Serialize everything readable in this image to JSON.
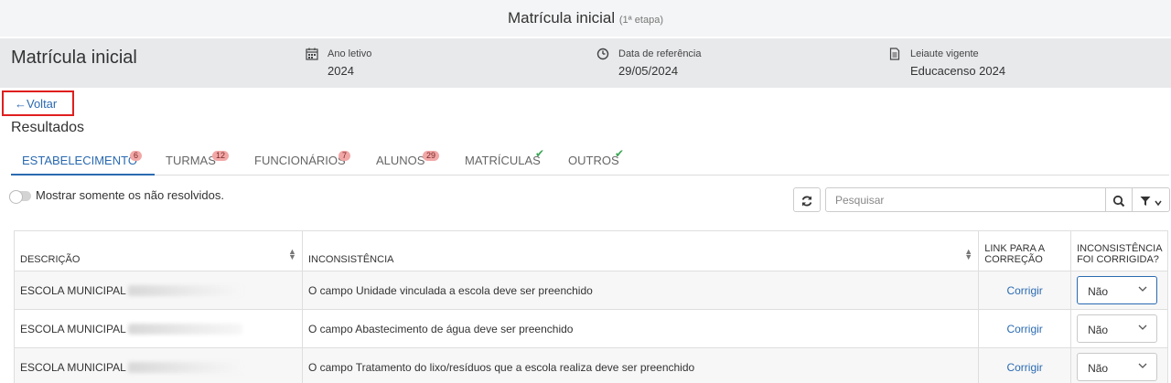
{
  "topbar": {
    "title": "Matrícula inicial",
    "subtitle": "(1ª etapa)"
  },
  "header": {
    "page_title": "Matrícula inicial",
    "meta": [
      {
        "label": "Ano letivo",
        "value": "2024",
        "icon": "calendar-icon"
      },
      {
        "label": "Data de referência",
        "value": "29/05/2024",
        "icon": "clock-icon"
      },
      {
        "label": "Leiaute vigente",
        "value": "Educacenso 2024",
        "icon": "document-icon"
      }
    ]
  },
  "back_label": "Voltar",
  "results_title": "Resultados",
  "tabs": [
    {
      "label": "ESTABELECIMENTO",
      "badge": "6",
      "active": true
    },
    {
      "label": "TURMAS",
      "badge": "12"
    },
    {
      "label": "FUNCIONÁRIOS",
      "badge": "7"
    },
    {
      "label": "ALUNOS",
      "badge": "29"
    },
    {
      "label": "MATRÍCULAS",
      "check": "✔"
    },
    {
      "label": "OUTROS",
      "check": "✔"
    }
  ],
  "toggle_label": "Mostrar somente os não resolvidos.",
  "search": {
    "placeholder": "Pesquisar"
  },
  "table": {
    "columns": [
      "DESCRIÇÃO",
      "INCONSISTÊNCIA",
      "LINK PARA A CORREÇÃO",
      "INCONSISTÊNCIA FOI CORRIGIDA?"
    ],
    "rows": [
      {
        "descricao": "ESCOLA MUNICIPAL",
        "inconsistencia": "O campo Unidade vinculada a escola deve ser preenchido",
        "link": "Corrigir",
        "corrigida": "Não"
      },
      {
        "descricao": "ESCOLA MUNICIPAL",
        "inconsistencia": "O campo Abastecimento de água deve ser preenchido",
        "link": "Corrigir",
        "corrigida": "Não"
      },
      {
        "descricao": "ESCOLA MUNICIPAL",
        "inconsistencia": "O campo Tratamento do lixo/resíduos que a escola realiza deve ser preenchido",
        "link": "Corrigir",
        "corrigida": "Não"
      }
    ]
  },
  "colors": {
    "accent": "#2a6ab1",
    "badge_bg": "#f2a7a7",
    "check": "#3aa655",
    "highlight": "#e01e1e"
  }
}
